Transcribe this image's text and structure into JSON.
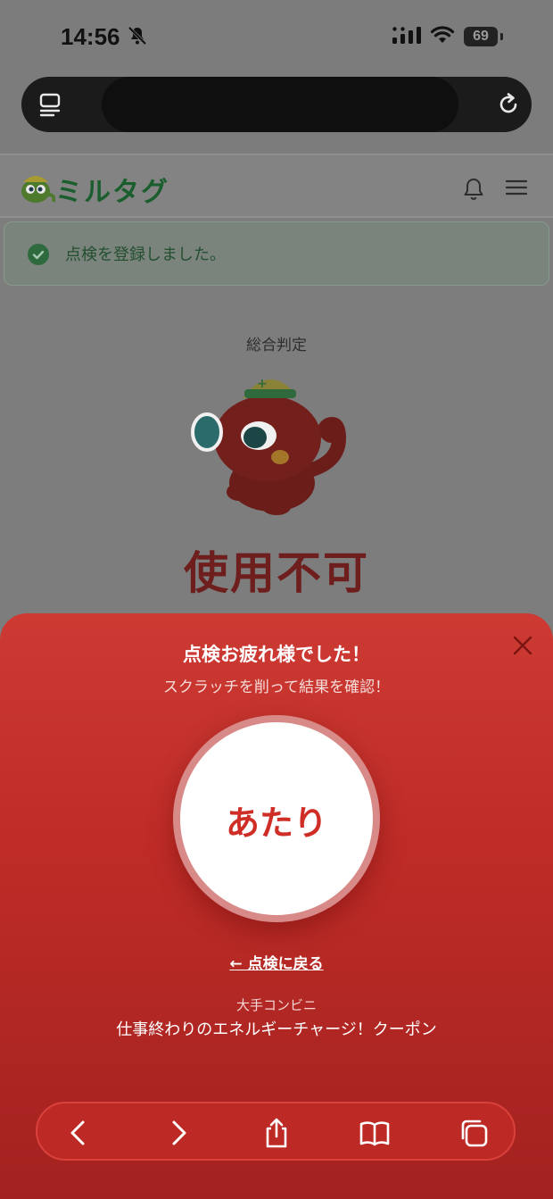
{
  "status_bar": {
    "time": "14:56",
    "battery": "69"
  },
  "site": {
    "logo_text": "ミルタグ",
    "alert_text": "点検を登録しました。",
    "judgement_label": "総合判定",
    "verdict": "使用不可"
  },
  "sheet": {
    "title": "点検お疲れ様でした！",
    "subtitle": "スクラッチを削って結果を確認！",
    "result": "あたり",
    "back_link": "← 点検に戻る",
    "sponsor": "大手コンビニ",
    "coupon": "仕事終わりのエネルギーチャージ！クーポン"
  },
  "colors": {
    "sheet_red": "#c4302b",
    "result_text": "#cf2e27",
    "brand_green": "#1b5e2e"
  },
  "icons": [
    "bell-off-icon",
    "signal-icon",
    "wifi-icon",
    "battery-icon",
    "tabs-icon",
    "reload-icon",
    "bell-icon",
    "menu-icon",
    "check-icon",
    "close-icon",
    "back-icon",
    "forward-icon",
    "share-icon",
    "bookmarks-icon",
    "tabs-overview-icon"
  ]
}
